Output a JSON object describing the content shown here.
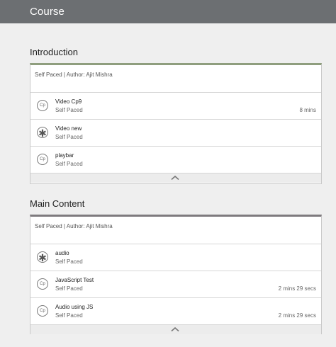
{
  "header": {
    "title": "Course"
  },
  "sections": [
    {
      "title": "Introduction",
      "meta": "Self Paced | Author: Ajit Mishra",
      "items": [
        {
          "icon": "cp-icon",
          "icon_text": "Cp",
          "name": "Video Cp9",
          "type": "Self Paced",
          "duration": "8 mins"
        },
        {
          "icon": "asterisk-icon",
          "icon_text": "✱",
          "name": "Video new",
          "type": "Self Paced",
          "duration": ""
        },
        {
          "icon": "cp-icon",
          "icon_text": "Cp",
          "name": "playbar",
          "type": "Self Paced",
          "duration": ""
        }
      ]
    },
    {
      "title": "Main Content",
      "meta": "Self Paced | Author: Ajit Mishra",
      "items": [
        {
          "icon": "asterisk-icon",
          "icon_text": "✱",
          "name": "audio",
          "type": "Self Paced",
          "duration": ""
        },
        {
          "icon": "cp-icon",
          "icon_text": "Cp",
          "name": "JavaScript Test",
          "type": "Self Paced",
          "duration": "2 mins 29 secs"
        },
        {
          "icon": "cp-icon",
          "icon_text": "Cp",
          "name": "Audio using JS",
          "type": "Self Paced",
          "duration": "2 mins 29 secs"
        }
      ]
    }
  ],
  "colors": {
    "topbar": "#6c6f72",
    "intro_accent": "#8f9e7e",
    "main_accent": "#7e7a7e"
  }
}
